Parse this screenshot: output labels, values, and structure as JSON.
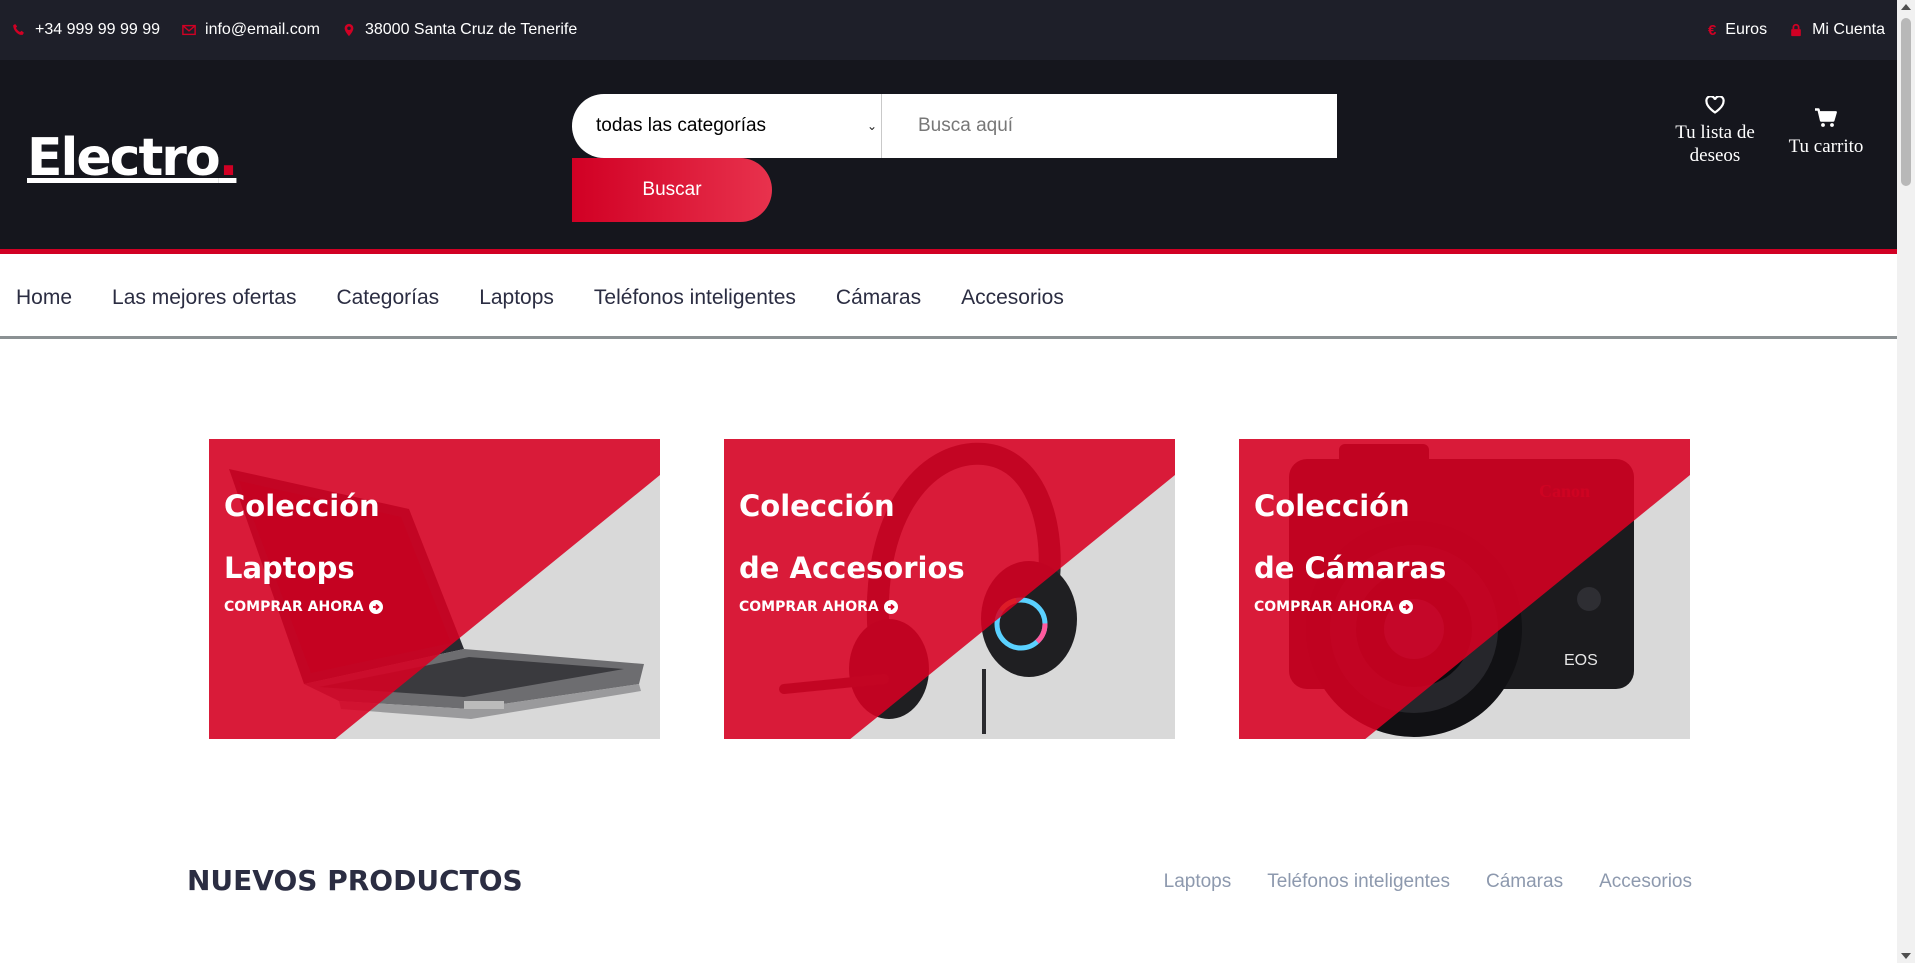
{
  "colors": {
    "brand": "#d10024",
    "topbar_bg": "#1e1f29",
    "header_bg": "#15161d",
    "nav_text": "#2b2d42",
    "tab_text": "#8d99ae"
  },
  "topbar": {
    "phone": "+34 999 99 99 99",
    "email": "info@email.com",
    "address": "38000 Santa Cruz de Tenerife",
    "currency": "Euros",
    "account": "Mi Cuenta",
    "icons": [
      "phone-icon",
      "envelope-icon",
      "map-marker-icon",
      "euro-icon",
      "lock-icon"
    ]
  },
  "header": {
    "logo_text": "Electro",
    "logo_dot": ".",
    "category_select": "todas las categorías",
    "search_placeholder": "Busca aquí",
    "search_button": "Buscar",
    "wishlist_line1": "Tu lista de",
    "wishlist_line2": "deseos",
    "cart": "Tu carrito",
    "icons": [
      "heart-icon",
      "cart-icon"
    ]
  },
  "nav": {
    "items": [
      "Home",
      "Las mejores ofertas",
      "Categorías",
      "Laptops",
      "Teléfonos inteligentes",
      "Cámaras",
      "Accesorios"
    ]
  },
  "collections": [
    {
      "line1": "Colección",
      "line2": "Laptops",
      "cta": "COMPRAR AHORA",
      "image": "laptop"
    },
    {
      "line1": "Colección",
      "line2": "de Accesorios",
      "cta": "COMPRAR AHORA",
      "image": "headset"
    },
    {
      "line1": "Colección",
      "line2": "de Cámaras",
      "cta": "COMPRAR AHORA",
      "image": "camera"
    }
  ],
  "new_products": {
    "title": "NUEVOS PRODUCTOS",
    "tabs": [
      "Laptops",
      "Teléfonos inteligentes",
      "Cámaras",
      "Accesorios"
    ]
  }
}
